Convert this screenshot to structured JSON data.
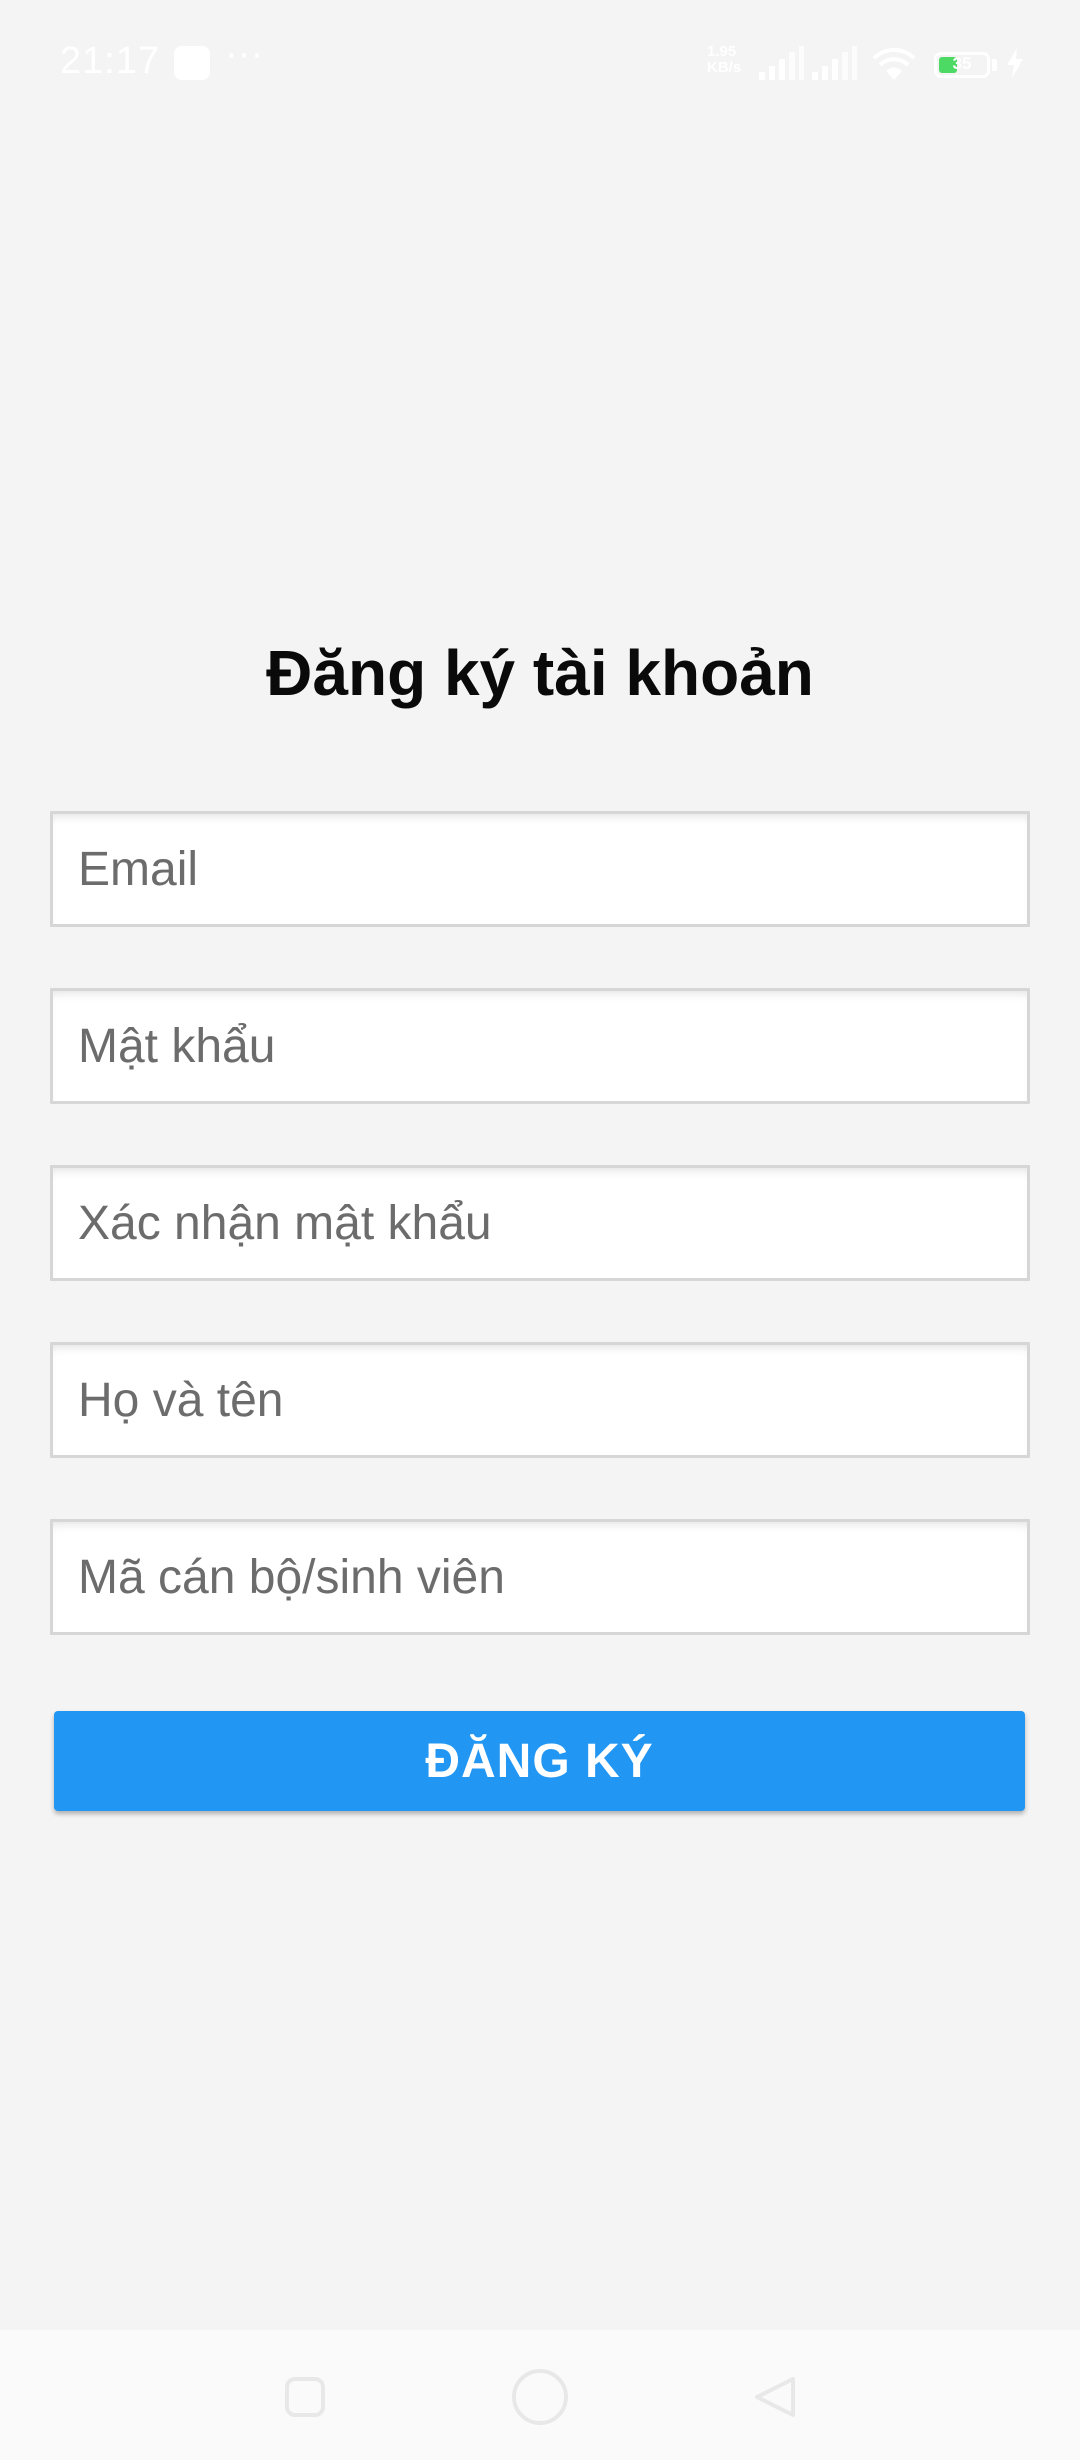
{
  "status_bar": {
    "time": "21:17",
    "more": "···",
    "net_speed_value": "1.95",
    "net_speed_unit": "KB/s",
    "battery_level": "35",
    "colors": {
      "battery_fill": "#4cd964"
    }
  },
  "form": {
    "title": "Đăng ký tài khoản",
    "fields": {
      "email": {
        "placeholder": "Email",
        "value": ""
      },
      "password": {
        "placeholder": "Mật khẩu",
        "value": ""
      },
      "confirm": {
        "placeholder": "Xác nhận mật khẩu",
        "value": ""
      },
      "full_name": {
        "placeholder": "Họ và tên",
        "value": ""
      },
      "staff_code": {
        "placeholder": "Mã cán bộ/sinh viên",
        "value": ""
      }
    },
    "submit_label": "ĐĂNG KÝ"
  },
  "nav_bar": {
    "icons": [
      "recents-icon",
      "home-icon",
      "back-icon"
    ]
  },
  "theme": {
    "background": "#f4f4f4",
    "accent": "#2196f3",
    "title_color": "#0a0a0a",
    "placeholder_color": "#6c6c6c",
    "input_border": "#d6d6d6"
  }
}
